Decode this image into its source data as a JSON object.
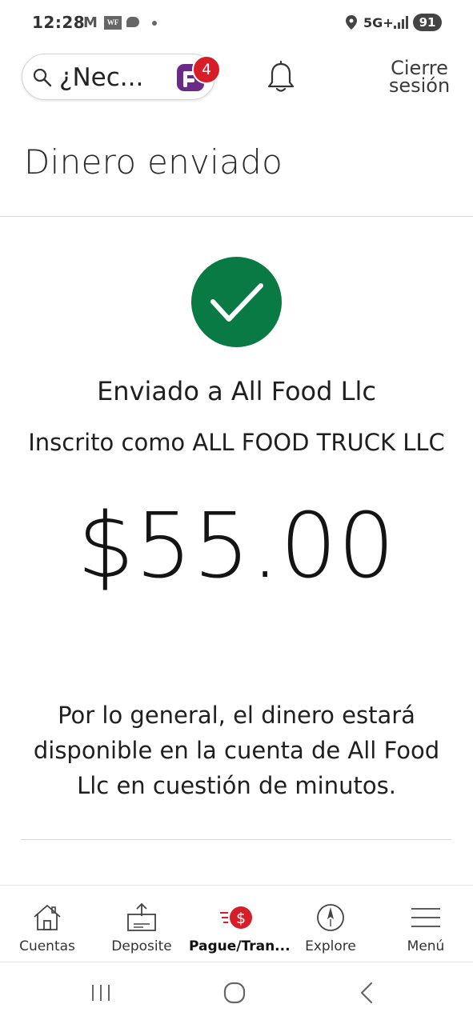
{
  "status_bar": {
    "time": "12:28",
    "notification_icons": [
      "gmail-icon",
      "wf-app-icon",
      "chat-icon",
      "more-dot-icon"
    ],
    "network": "5G+",
    "battery": "91"
  },
  "header": {
    "search_text": "¿Nec...",
    "badge_count": "4",
    "logout_label": "Cierre sesión",
    "icons": [
      "search-icon",
      "fargo-assistant-icon",
      "bell-icon"
    ]
  },
  "page": {
    "title": "Dinero enviado"
  },
  "confirmation": {
    "sent_to": "Enviado a All Food Llc",
    "enrolled_as": "Inscrito como ALL FOOD TRUCK LLC",
    "amount": "$55.00",
    "note": "Por lo general, el dinero estará disponible en la cuenta de All Food Llc en cuestión de minutos.",
    "check_color": "#0a7a45"
  },
  "bottom_nav": {
    "items": [
      {
        "label": "Cuentas",
        "icon": "home-icon"
      },
      {
        "label": "Deposite",
        "icon": "deposit-icon"
      },
      {
        "label": "Pague/Tran...",
        "icon": "pay-transfer-icon",
        "active": true
      },
      {
        "label": "Explore",
        "icon": "compass-icon"
      },
      {
        "label": "Menú",
        "icon": "hamburger-menu-icon"
      }
    ],
    "accent_color": "#d71e28"
  },
  "system_nav": {
    "icons": [
      "recent-apps-icon",
      "home-circle-icon",
      "back-icon"
    ]
  }
}
